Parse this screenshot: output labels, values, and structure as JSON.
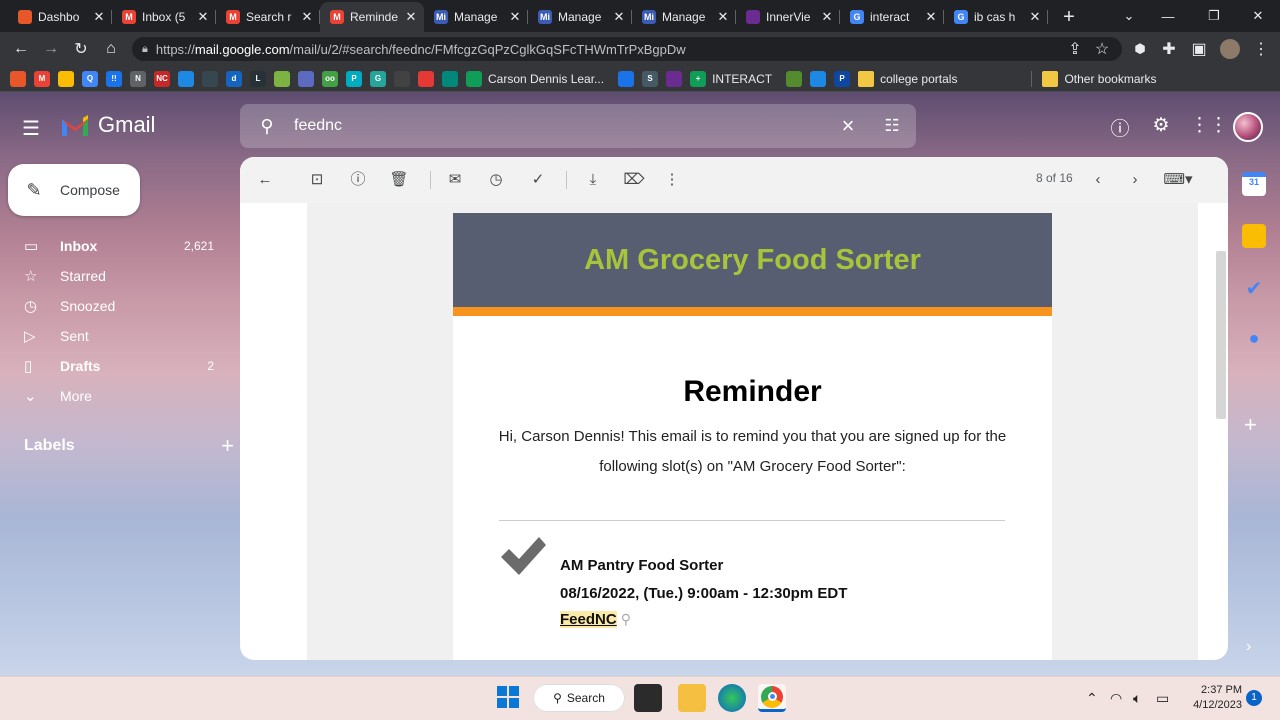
{
  "browser": {
    "tabs": [
      {
        "title": "Dashbo",
        "fav_color": "#e8572a",
        "fav_text": "",
        "active": false
      },
      {
        "title": "Inbox (5",
        "fav_color": "#ea4335",
        "fav_text": "M",
        "active": false
      },
      {
        "title": "Search r",
        "fav_color": "#ea4335",
        "fav_text": "M",
        "active": false
      },
      {
        "title": "Reminde",
        "fav_color": "#ea4335",
        "fav_text": "M",
        "active": true
      },
      {
        "title": "Manage",
        "fav_color": "#3b5bb5",
        "fav_text": "Mi",
        "active": false
      },
      {
        "title": "Manage",
        "fav_color": "#3b5bb5",
        "fav_text": "Mi",
        "active": false
      },
      {
        "title": "Manage",
        "fav_color": "#3b5bb5",
        "fav_text": "Mi",
        "active": false
      },
      {
        "title": "InnerVie",
        "fav_color": "#6a2c91",
        "fav_text": "",
        "active": false
      },
      {
        "title": "interact",
        "fav_color": "#4285f4",
        "fav_text": "G",
        "active": false
      },
      {
        "title": "ib cas h",
        "fav_color": "#4285f4",
        "fav_text": "G",
        "active": false
      }
    ],
    "close_glyph": "✕",
    "url_prefix": "https://",
    "url_host": "mail.google.com",
    "url_path": "/mail/u/2/#search/feednc/FMfcgzGqPzCglkGqSFcTHWmTrPxBgpDw",
    "bookmarks": [
      {
        "color": "#e8572a",
        "text": ""
      },
      {
        "color": "#ea4335",
        "text": "M"
      },
      {
        "color": "#fbbc04",
        "text": ""
      },
      {
        "color": "#4285f4",
        "text": "Q"
      },
      {
        "color": "#1a73e8",
        "text": "!!"
      },
      {
        "color": "#5f6368",
        "text": "N"
      },
      {
        "color": "#c62828",
        "text": "NC"
      },
      {
        "color": "#1e88e5",
        "text": ""
      },
      {
        "color": "#37474f",
        "text": ""
      },
      {
        "color": "#1565c0",
        "text": "d"
      },
      {
        "color": "#263238",
        "text": "L"
      },
      {
        "color": "#7cb342",
        "text": ""
      },
      {
        "color": "#5c6bc0",
        "text": ""
      },
      {
        "color": "#43a047",
        "text": "oo"
      },
      {
        "color": "#00acc1",
        "text": "P"
      },
      {
        "color": "#26a69a",
        "text": "G"
      },
      {
        "color": "#424242",
        "text": ""
      },
      {
        "color": "#e53935",
        "text": ""
      },
      {
        "color": "#00897b",
        "text": ""
      }
    ],
    "bookmark_named": [
      {
        "color": "#0f9d58",
        "text": "Carson Dennis Lear..."
      }
    ],
    "bookmarks_tail": [
      {
        "color": "#1a73e8",
        "text": ""
      },
      {
        "color": "#455a64",
        "text": "S"
      },
      {
        "color": "#6a2c91",
        "text": ""
      }
    ],
    "bookmark_interact": "INTERACT",
    "bookmarks_tail2": [
      {
        "color": "#558b2f",
        "text": ""
      },
      {
        "color": "#1e88e5",
        "text": ""
      },
      {
        "color": "#0d47a1",
        "text": "P"
      }
    ],
    "folder_college": "college portals",
    "folder_other": "Other bookmarks"
  },
  "gmail": {
    "app_name": "Gmail",
    "search_query": "feednc",
    "compose_label": "Compose",
    "nav": [
      {
        "label": "Inbox",
        "count": "2,621",
        "icon": "▭",
        "bold": true
      },
      {
        "label": "Starred",
        "count": "",
        "icon": "☆",
        "bold": false
      },
      {
        "label": "Snoozed",
        "count": "",
        "icon": "◷",
        "bold": false
      },
      {
        "label": "Sent",
        "count": "",
        "icon": "▷",
        "bold": false
      },
      {
        "label": "Drafts",
        "count": "2",
        "icon": "▯",
        "bold": true
      },
      {
        "label": "More",
        "count": "",
        "icon": "⌄",
        "bold": false
      }
    ],
    "labels_heading": "Labels",
    "pager": "8 of 16"
  },
  "email": {
    "banner_title": "AM Grocery Food Sorter",
    "heading": "Reminder",
    "body": "Hi, Carson Dennis! This email is to remind you that you are signed up for the following slot(s) on \"AM Grocery Food Sorter\":",
    "slot_name": "AM Pantry Food Sorter",
    "slot_time": "08/16/2022, (Tue.) 9:00am - 12:30pm EDT",
    "slot_location": "FeedNC"
  },
  "taskbar": {
    "search_label": "Search",
    "time": "2:37 PM",
    "date": "4/12/2023",
    "notification_count": "1"
  },
  "colors": {
    "banner_bg": "#575e72",
    "banner_text": "#a8c43a",
    "accent_orange": "#f7941d"
  }
}
